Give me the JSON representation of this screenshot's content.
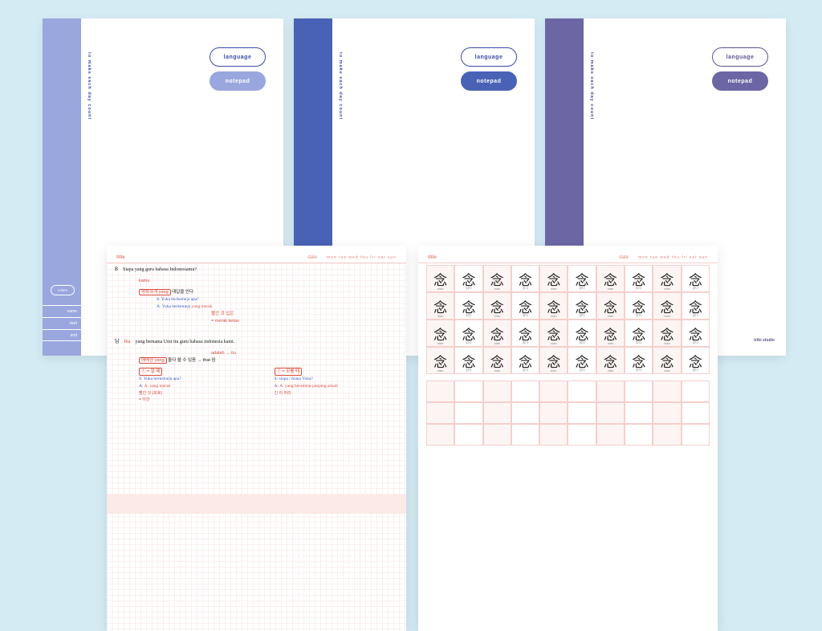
{
  "tagline": "to make each day count",
  "badge_language": "language",
  "badge_notepad": "notepad",
  "colors_btn": "colors",
  "fields": [
    "name",
    "start",
    "end"
  ],
  "brand": "tribi studio",
  "page": {
    "title": "title",
    "date": "date",
    "days": "mon tue wed thu fri sat sun"
  },
  "notes": {
    "q_letter": "B",
    "q_text": "Siapa yang guru bahasa Indonesiamu?",
    "q_hint": "kamu",
    "tag1a": "명확하게 yang",
    "tag1b": "대답을 안다",
    "l1": "S: Yuka berkemeja apa?",
    "l2": "A: Yuka berkemeja",
    "l2b": "yang merah",
    "l3a": "빨간 것 입은",
    "l3b": "= merak ketas",
    "a_letter": "답",
    "a_pre": "Ibu",
    "a_text": "yang bernama Umi itu guru bahasa indonesia kami.",
    "a_hint": "adalah → itu",
    "tag2a": "애매한 yang",
    "tag2b": "둘다 쓸 수 있음 → that 임",
    "cmp_l": "① = 알 때",
    "cmp_lq": "S: Yuka berkemeja apa?",
    "cmp_la": "A: yang merah",
    "cmp_lnote": "빨간 것 (모호)\n= 이것",
    "cmp_r": "① = 모를 때",
    "cmp_rq": "S: siapa / mana Yuka?",
    "cmp_ra": "A: yang berambut panjang sekali",
    "cmp_rnote": "긴 이 머리"
  },
  "char_grid": {
    "char": "念",
    "pron_a": "niàn",
    "pron_b": "읽다"
  }
}
